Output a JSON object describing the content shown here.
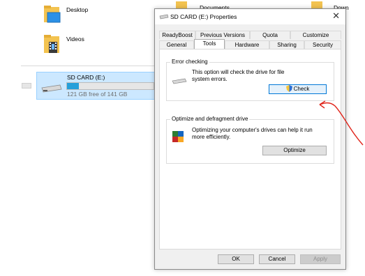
{
  "explorer": {
    "folders": [
      {
        "label": "Desktop"
      },
      {
        "label": "Videos"
      },
      {
        "label": "Documents"
      },
      {
        "label": "Down"
      }
    ],
    "drive": {
      "name": "SD CARD (E:)",
      "free_text": "121 GB free of 141 GB",
      "used_fraction": 0.14
    }
  },
  "dialog": {
    "title": "SD CARD (E:) Properties",
    "close_glyph": "✕",
    "tabs_row1": [
      "ReadyBoost",
      "Previous Versions",
      "Quota",
      "Customize"
    ],
    "tabs_row2": [
      "General",
      "Tools",
      "Hardware",
      "Sharing",
      "Security"
    ],
    "active_tab": "Tools",
    "error_checking": {
      "title": "Error checking",
      "description": "This option will check the drive for file system errors.",
      "button": "Check"
    },
    "optimize": {
      "title": "Optimize and defragment drive",
      "description": "Optimizing your computer's drives can help it run more efficiently.",
      "button": "Optimize"
    },
    "footer": {
      "ok": "OK",
      "cancel": "Cancel",
      "apply": "Apply"
    }
  },
  "colors": {
    "accent": "#0078d7",
    "selection": "#cce8ff",
    "annotation_arrow": "#e0251b"
  },
  "icons": [
    "folder-icon",
    "video-folder-icon",
    "drive-icon",
    "shield-icon",
    "defrag-icon",
    "close-icon"
  ]
}
